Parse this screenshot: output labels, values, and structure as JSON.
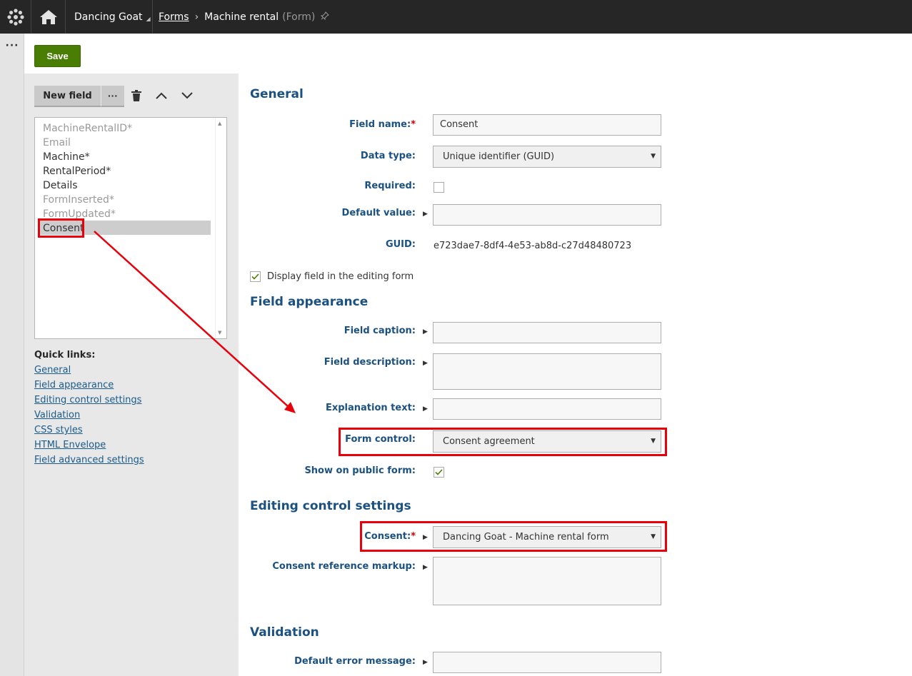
{
  "topbar": {
    "site_name": "Dancing Goat",
    "breadcrumb_link": "Forms",
    "page_title": "Machine rental",
    "page_subtitle": "(Form)"
  },
  "toolbar": {
    "save_label": "Save"
  },
  "fields_panel": {
    "new_field_label": "New field",
    "more_label": "···",
    "items": [
      {
        "label": "MachineRentalID*",
        "dim": true
      },
      {
        "label": "Email",
        "dim": true
      },
      {
        "label": "Machine*",
        "dim": false
      },
      {
        "label": "RentalPeriod*",
        "dim": false
      },
      {
        "label": "Details",
        "dim": false
      },
      {
        "label": "FormInserted*",
        "dim": true
      },
      {
        "label": "FormUpdated*",
        "dim": true
      },
      {
        "label": "Consent",
        "dim": false,
        "selected": true
      }
    ],
    "quick_links_title": "Quick links:",
    "quick_links": [
      "General",
      "Field appearance",
      "Editing control settings",
      "Validation",
      "CSS styles",
      "HTML Envelope",
      "Field advanced settings"
    ]
  },
  "general": {
    "heading": "General",
    "field_name_label": "Field name:",
    "field_name_value": "Consent",
    "data_type_label": "Data type:",
    "data_type_value": "Unique identifier (GUID)",
    "required_label": "Required:",
    "required_checked": false,
    "default_value_label": "Default value:",
    "default_value": "",
    "guid_label": "GUID:",
    "guid_value": "e723dae7-8df4-4e53-ab8d-c27d48480723",
    "display_field_label": "Display field in the editing form",
    "display_field_checked": true
  },
  "appearance": {
    "heading": "Field appearance",
    "caption_label": "Field caption:",
    "caption_value": "",
    "description_label": "Field description:",
    "explanation_label": "Explanation text:",
    "form_control_label": "Form control:",
    "form_control_value": "Consent agreement",
    "show_public_label": "Show on public form:",
    "show_public_checked": true
  },
  "editing": {
    "heading": "Editing control settings",
    "consent_label": "Consent:",
    "consent_value": "Dancing Goat - Machine rental form",
    "markup_label": "Consent reference markup:"
  },
  "validation": {
    "heading": "Validation",
    "error_label": "Default error message:",
    "error_value": ""
  },
  "colors": {
    "accent": "#1b5181",
    "save": "#497d04",
    "highlight": "#e8000b",
    "topbar": "#262626"
  },
  "icons": [
    "kentico-logo-icon",
    "home-icon",
    "pin-icon",
    "delete-icon",
    "chevron-up-icon",
    "chevron-down-icon",
    "expand-arrow-icon",
    "dropdown-caret-icon",
    "checkmark-icon"
  ]
}
